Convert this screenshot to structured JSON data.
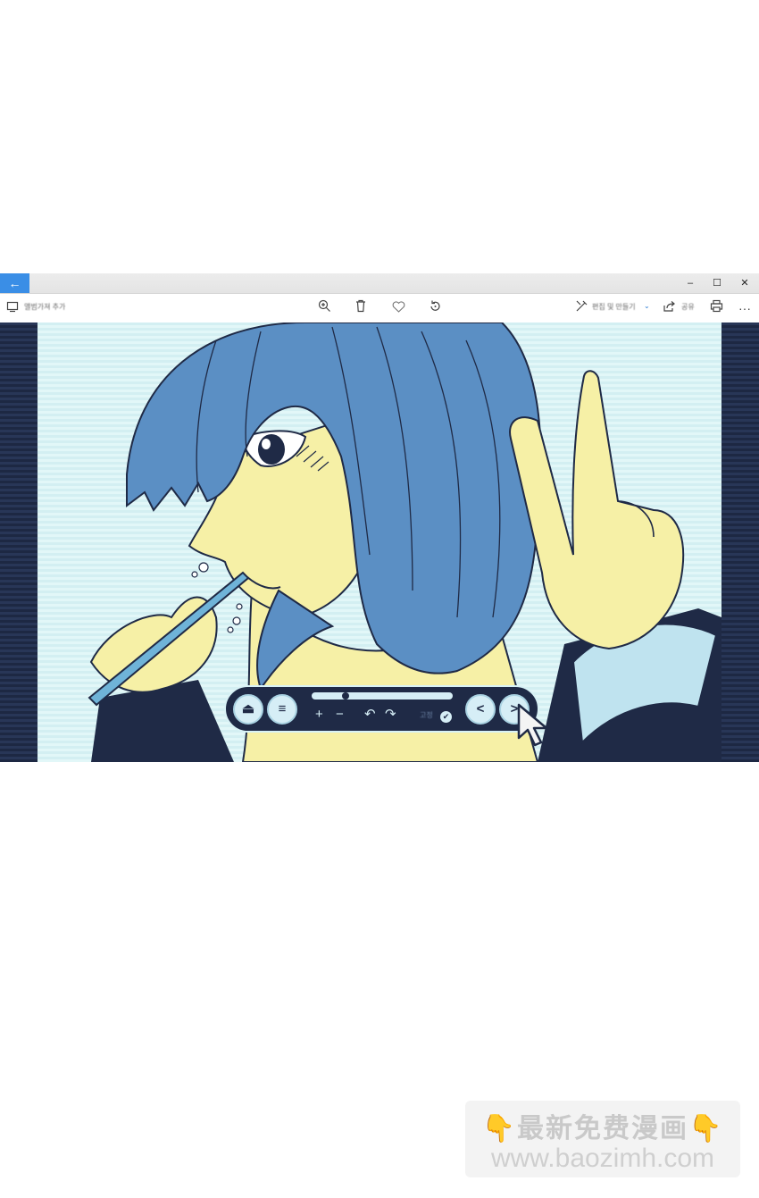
{
  "window": {
    "back_glyph": "←",
    "controls": {
      "minimize": "–",
      "maximize": "☐",
      "close": "✕"
    }
  },
  "toolbar": {
    "add_to_album_label": "앨범가져 추가",
    "edit_create_label": "편집 및 만들기",
    "share_label": "공유",
    "more_glyph": "···",
    "icons": [
      "album-icon",
      "zoom-in-icon",
      "delete-icon",
      "favorite-icon",
      "rotate-icon",
      "edit-icon",
      "share-icon",
      "print-icon"
    ]
  },
  "media_controls": {
    "eject_glyph": "⏏",
    "menu_glyph": "≡",
    "plus_glyph": "+",
    "minus_glyph": "−",
    "undo_glyph": "↶",
    "redo_glyph": "↷",
    "confirm_label": "고정",
    "check_glyph": "✔",
    "prev_glyph": "<",
    "next_glyph": ">",
    "progress": 0.24
  },
  "watermark": {
    "line1": "最新免费漫画",
    "line2": "www.baozimh.com",
    "finger_glyph": "👇"
  },
  "colors": {
    "accent": "#3a8ee6",
    "hair": "#5b8fc4",
    "skin": "#f6f0a6",
    "background_light": "#dff6f8",
    "dark_navy": "#1f2a46"
  }
}
